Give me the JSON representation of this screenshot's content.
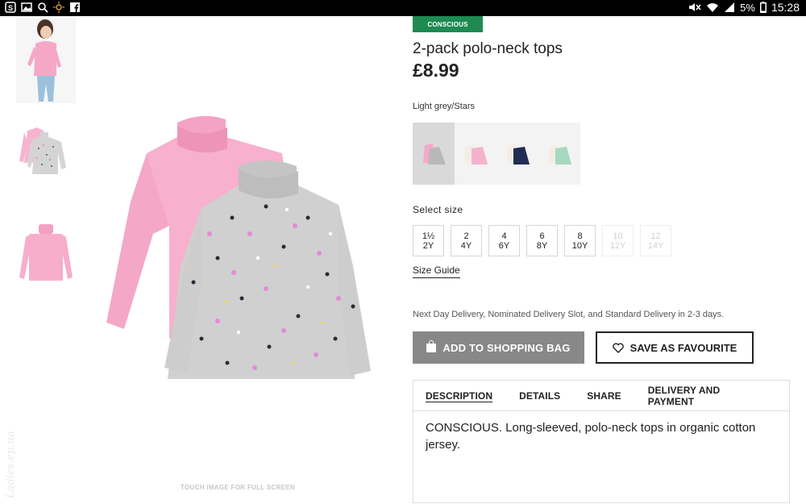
{
  "status_bar": {
    "battery": "5%",
    "time": "15:28"
  },
  "gallery": {
    "touch_caption": "TOUCH IMAGE FOR FULL SCREEN",
    "watermark": "Ladies.ep.ua"
  },
  "product": {
    "badge": "CONSCIOUS",
    "title": "2-pack polo-neck tops",
    "price": "£8.99",
    "color_name": "Light grey/Stars"
  },
  "size": {
    "label": "Select size",
    "options": [
      {
        "line1": "1½",
        "line2": "2Y",
        "available": true
      },
      {
        "line1": "2",
        "line2": "4Y",
        "available": true
      },
      {
        "line1": "4",
        "line2": "6Y",
        "available": true
      },
      {
        "line1": "6",
        "line2": "8Y",
        "available": true
      },
      {
        "line1": "8",
        "line2": "10Y",
        "available": true
      },
      {
        "line1": "10",
        "line2": "12Y",
        "available": false
      },
      {
        "line1": "12",
        "line2": "14Y",
        "available": false
      }
    ],
    "guide": "Size Guide"
  },
  "delivery": "Next Day Delivery, Nominated Delivery Slot, and Standard Delivery in 2-3 days.",
  "actions": {
    "add_to_bag": "ADD TO SHOPPING BAG",
    "save_favourite": "SAVE AS FAVOURITE"
  },
  "tabs": {
    "items": [
      "DESCRIPTION",
      "DETAILS",
      "SHARE",
      "DELIVERY AND PAYMENT"
    ],
    "content": "CONSCIOUS. Long-sleeved, polo-neck tops in organic cotton jersey."
  },
  "colors": {
    "badge_green": "#1e8a52",
    "button_grey": "#888888",
    "pink": "#f4a9c8",
    "grey": "#c9c9c9",
    "navy": "#1f2d52",
    "mint": "#a6d8c0"
  }
}
